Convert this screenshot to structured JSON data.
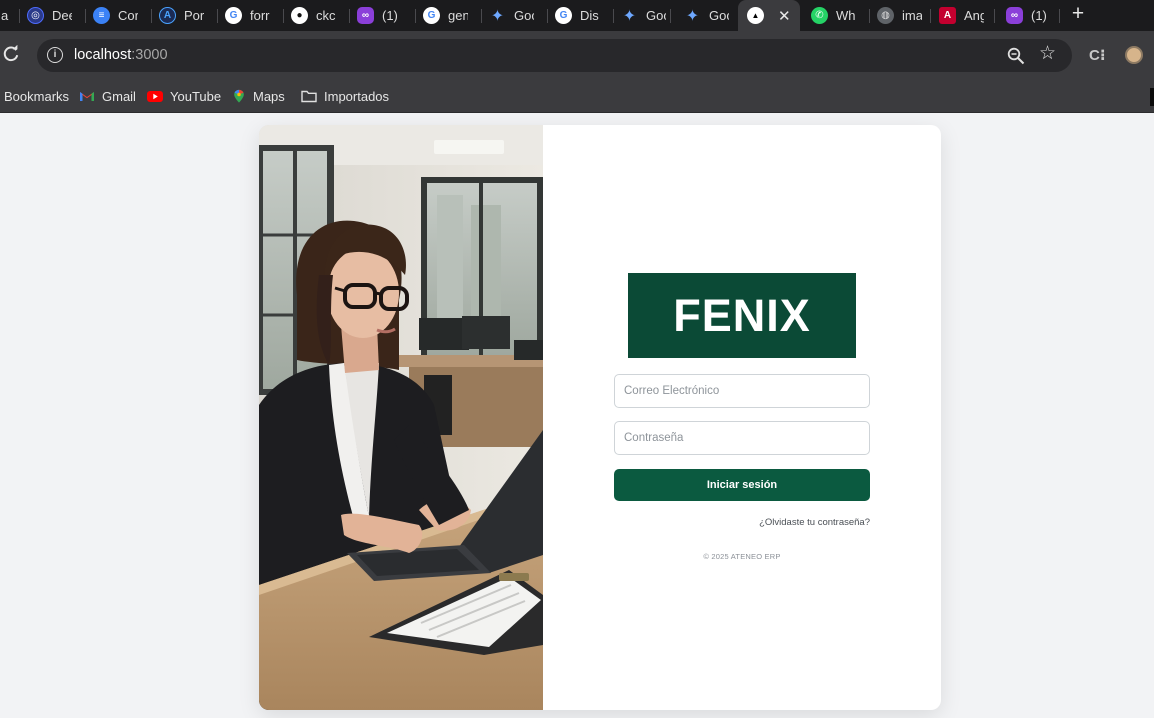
{
  "browser": {
    "tabs": [
      {
        "title": "a",
        "icon": "globe-icon",
        "color": "#5f6368",
        "active": false
      },
      {
        "title": "Dee",
        "icon": "deepseek-icon",
        "color": "#4d6bfe",
        "active": false
      },
      {
        "title": "Cor",
        "icon": "doc-icon",
        "color": "#3b82f6",
        "active": false
      },
      {
        "title": "Por",
        "icon": "azure-icon",
        "color": "#1d6fd6",
        "active": false
      },
      {
        "title": "forr",
        "icon": "google-icon",
        "color": "#ffffff",
        "active": false
      },
      {
        "title": "ckc",
        "icon": "github-icon",
        "color": "#ffffff",
        "active": false
      },
      {
        "title": "(1)",
        "icon": "purple-app-icon",
        "color": "#8b3fd9",
        "active": false
      },
      {
        "title": "gen",
        "icon": "google-icon",
        "color": "#ffffff",
        "active": false
      },
      {
        "title": "Goo",
        "icon": "gemini-icon",
        "color": "#6ea8ff",
        "active": false
      },
      {
        "title": "Dis",
        "icon": "google-icon",
        "color": "#ffffff",
        "active": false
      },
      {
        "title": "Goo",
        "icon": "gemini-icon",
        "color": "#6ea8ff",
        "active": false
      },
      {
        "title": "Goo",
        "icon": "gemini-icon",
        "color": "#6ea8ff",
        "active": false
      },
      {
        "title": "",
        "icon": "nextjs-icon",
        "color": "#000000",
        "active": true
      },
      {
        "title": "Wh",
        "icon": "whatsapp-icon",
        "color": "#25d366",
        "active": false
      },
      {
        "title": "ima",
        "icon": "globe-icon",
        "color": "#9aa0a6",
        "active": false
      },
      {
        "title": "Ang",
        "icon": "angular-icon",
        "color": "#c3002f",
        "active": false
      },
      {
        "title": "(1)",
        "icon": "purple-app-icon",
        "color": "#8b3fd9",
        "active": false
      }
    ],
    "new_tab": "+",
    "close_glyph": "✕",
    "url_host": "localhost",
    "url_port": ":3000",
    "bookmarks": [
      {
        "label": "Bookmarks",
        "icon": ""
      },
      {
        "label": "Gmail",
        "icon": "gmail-icon"
      },
      {
        "label": "YouTube",
        "icon": "youtube-icon"
      },
      {
        "label": "Maps",
        "icon": "maps-icon"
      },
      {
        "label": "Importados",
        "icon": "folder-icon"
      }
    ]
  },
  "login": {
    "logo_text": "FENIX",
    "email_placeholder": "Correo Electrónico",
    "password_placeholder": "Contraseña",
    "submit_label": "Iniciar sesión",
    "forgot_label": "¿Olvidaste tu contraseña?",
    "copyright": "© 2025 ATENEO ERP"
  },
  "colors": {
    "brand_green": "#0b4a36",
    "button_green": "#0b5a40",
    "page_bg": "#f2f3f5"
  }
}
